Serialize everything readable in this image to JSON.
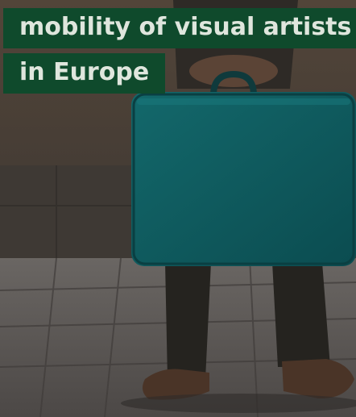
{
  "card": {
    "title_lines": [
      "mobility of visual artists",
      "in Europe"
    ]
  },
  "colors": {
    "title_bg": "#0f4a2c",
    "title_text": "#dfe6dd",
    "suitcase": "#0f5f63",
    "wall": "#4f4437",
    "pavement": "#575250"
  },
  "image": {
    "subject": "person-holding-teal-suitcase"
  }
}
